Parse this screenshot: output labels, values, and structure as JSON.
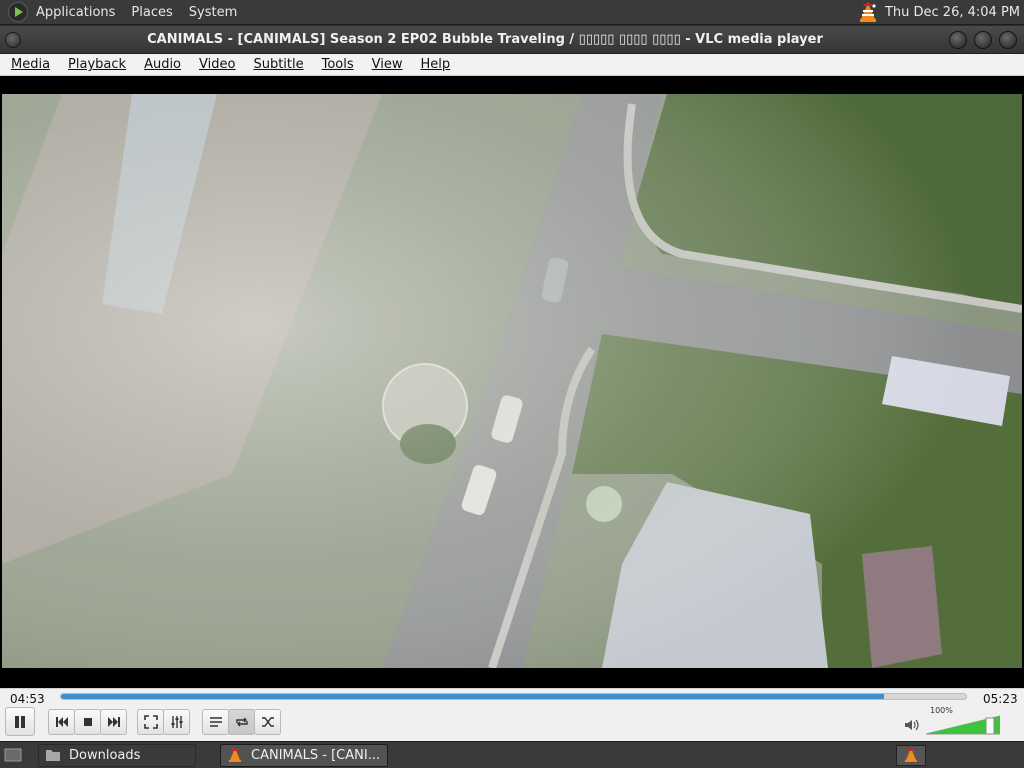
{
  "top_panel": {
    "menus": [
      "Applications",
      "Places",
      "System"
    ],
    "clock": "Thu Dec 26,  4:04 PM"
  },
  "window": {
    "title": "CANIMALS - [CANIMALS] Season 2 EP02 Bubble Traveling / ▯▯▯▯▯ ▯▯▯▯ ▯▯▯▯ - VLC media player"
  },
  "menubar": {
    "items": [
      {
        "label": "Media"
      },
      {
        "label": "Playback"
      },
      {
        "label": "Audio"
      },
      {
        "label": "Video"
      },
      {
        "label": "Subtitle"
      },
      {
        "label": "Tools"
      },
      {
        "label": "View"
      },
      {
        "label": "Help"
      }
    ]
  },
  "player": {
    "elapsed": "04:53",
    "total": "05:23",
    "progress": 0.909,
    "volume_label": "100%",
    "volume": 1.0,
    "loop_active": true
  },
  "colors": {
    "seek_fill": "#3f8ecd",
    "volume_fill": "#3cc43c",
    "panel_bg": "#3a3a3a"
  },
  "icons": {
    "pause": "pause-icon",
    "prev": "skip-previous-icon",
    "stop": "stop-icon",
    "next": "skip-next-icon",
    "fullscreen": "fullscreen-icon",
    "equalizer": "extended-settings-icon",
    "playlist": "playlist-icon",
    "loop": "loop-icon",
    "random": "shuffle-icon",
    "volume": "speaker-icon"
  },
  "taskbar": {
    "items": [
      {
        "label": "Downloads"
      },
      {
        "label": "CANIMALS - [CANI..."
      }
    ]
  }
}
